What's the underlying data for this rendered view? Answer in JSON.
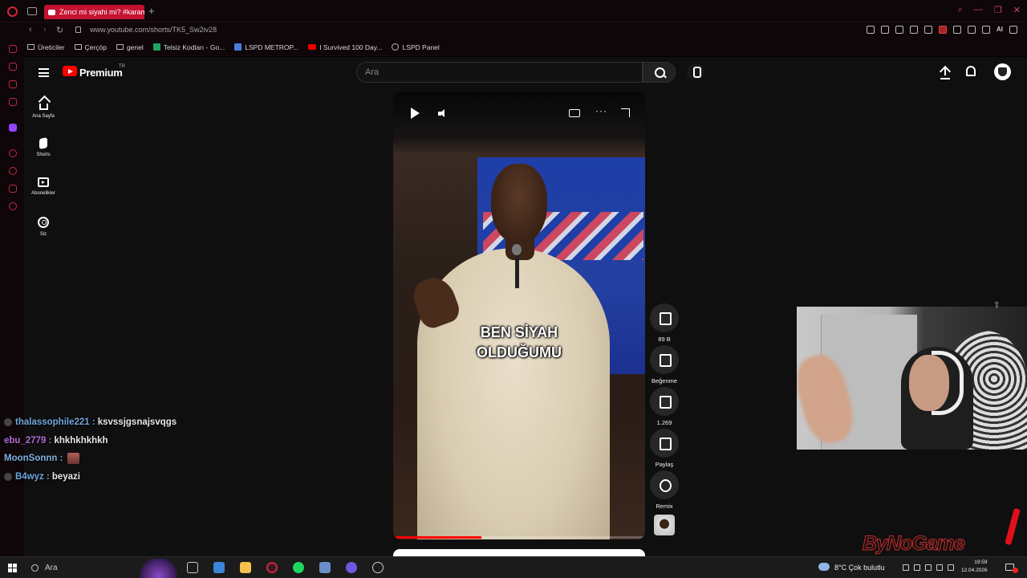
{
  "browser": {
    "tab_title": "Zenci mi siyahi mi? #karam",
    "url": "www.youtube.com/shorts/TK5_Sw2iv28",
    "ai_label": "AI"
  },
  "bookmarks": [
    {
      "label": "Üreticiler",
      "icon": "folder-icon"
    },
    {
      "label": "Çerçöp",
      "icon": "folder-icon"
    },
    {
      "label": "genel",
      "icon": "folder-icon"
    },
    {
      "label": "Telsiz Kodları - Go...",
      "icon": "sheets-icon"
    },
    {
      "label": "LSPD METROP...",
      "icon": "docs-icon"
    },
    {
      "label": "I Survived 100 Day...",
      "icon": "youtube-icon"
    },
    {
      "label": "LSPD Panel",
      "icon": "globe-icon"
    }
  ],
  "youtube": {
    "brand": "Premium",
    "country": "TR",
    "search_placeholder": "Ara",
    "nav": [
      {
        "label": "Ana Sayfa",
        "icon": "home-icon"
      },
      {
        "label": "Shorts",
        "icon": "shorts-icon"
      },
      {
        "label": "Abonelikler",
        "icon": "subscriptions-icon"
      },
      {
        "label": "Siz",
        "icon": "you-icon"
      }
    ]
  },
  "short": {
    "caption_line1": "BEN SİYAH",
    "caption_line2": "OLDUĞUMU",
    "progress_percent": 35,
    "actions": {
      "like_count": "89 B",
      "dislike_label": "Beğenme",
      "comment_count": "1.269",
      "share_label": "Paylaş",
      "remix_label": "Remix"
    }
  },
  "chat": [
    {
      "user": "thalassophile221",
      "message": "ksvssjgsnajsvqgs",
      "color": "#6fa8dc",
      "badge": true
    },
    {
      "user": "ebu_2779",
      "message": "khkhkhkhkh",
      "color": "#b36bd6",
      "badge": false
    },
    {
      "user": "MoonSonnn",
      "message": "",
      "color": "#7fb0e0",
      "badge": false,
      "emote": true
    },
    {
      "user": "B4wyz",
      "message": "beyazi",
      "color": "#6fa8dc",
      "badge": true
    }
  ],
  "watermark": "ByNoGame",
  "taskbar": {
    "search_placeholder": "Ara",
    "weather": "8°C  Çok bulutlu",
    "time": "19:59",
    "date": "12.04.2026"
  }
}
